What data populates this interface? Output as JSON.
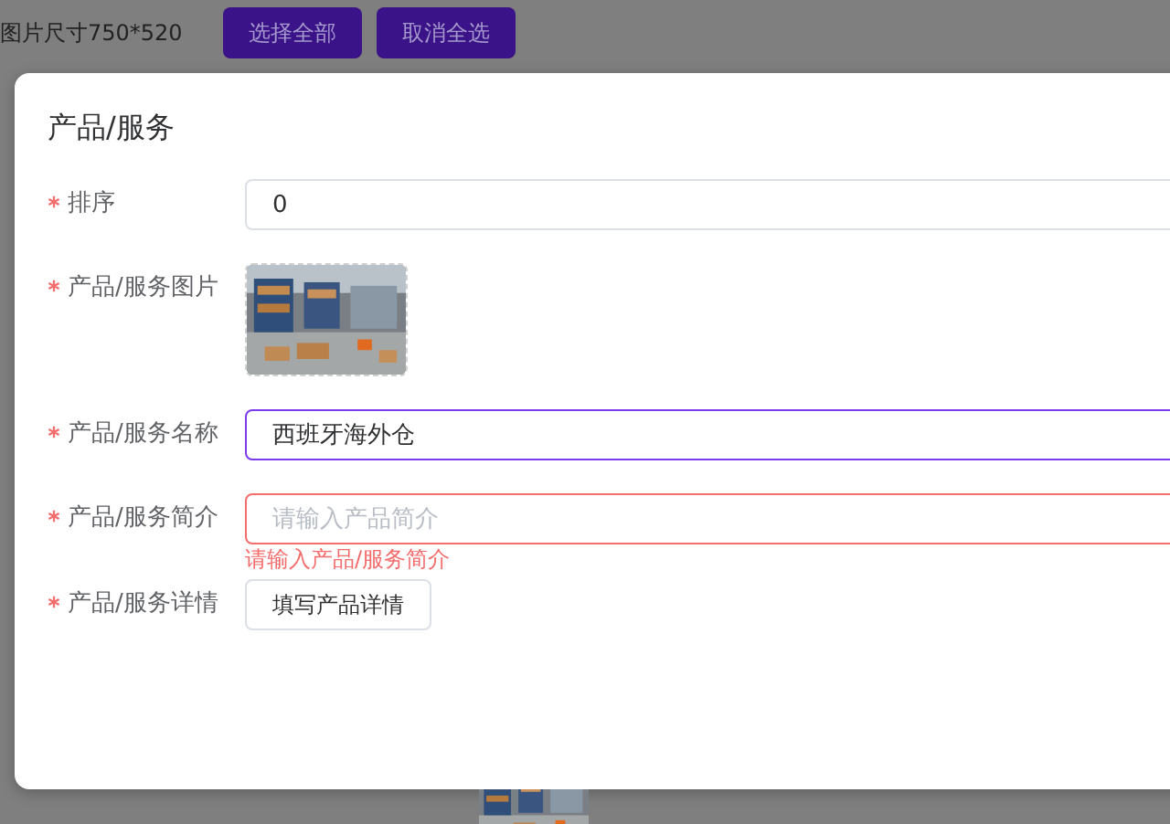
{
  "toolbar": {
    "note": "图片尺寸750*520",
    "buttons": [
      "选择全部",
      "取消全选"
    ]
  },
  "dialog": {
    "title": "产品/服务",
    "fields": [
      {
        "kind": "input",
        "label": "排序",
        "required": true,
        "value": "0",
        "focused": false,
        "invalid": false
      },
      {
        "label": "产品/服务图片",
        "required": true
      },
      {
        "kind": "input",
        "label": "产品/服务名称",
        "required": true,
        "value": "西班牙海外仓",
        "focused": true,
        "invalid": false
      },
      {
        "kind": "input",
        "label": "产品/服务简介",
        "required": true,
        "placeholder": "请输入产品简介",
        "focused": false,
        "invalid": true,
        "error": "请输入产品/服务简介"
      },
      {
        "kind": "button",
        "label": "产品/服务详情",
        "required": true,
        "button": "填写产品详情"
      }
    ]
  }
}
